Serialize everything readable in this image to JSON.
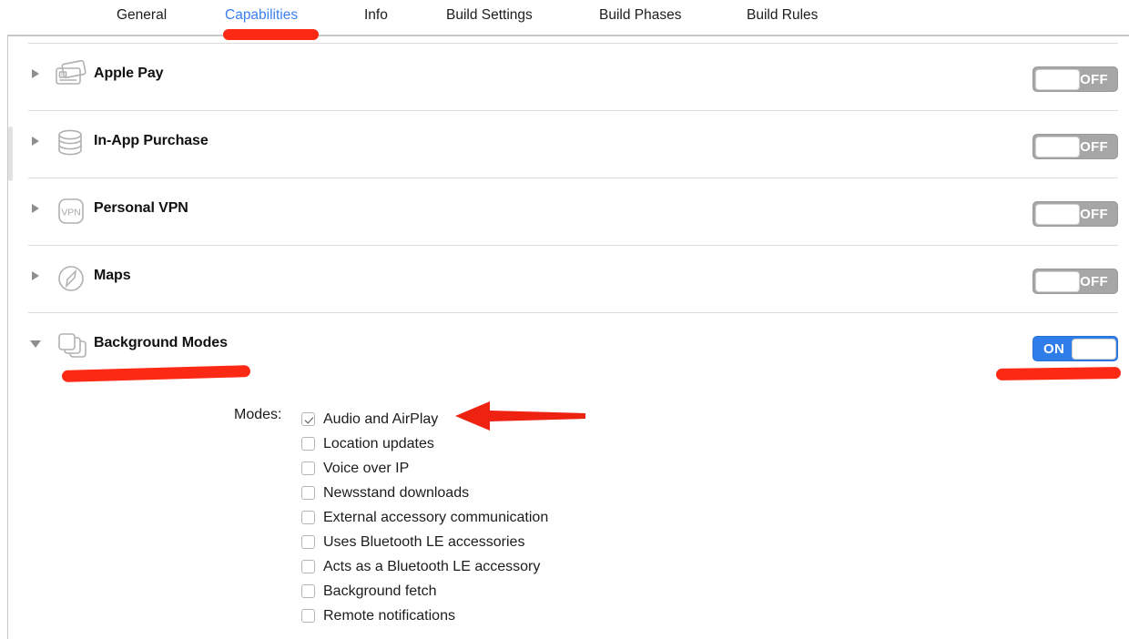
{
  "tabs": [
    {
      "label": "General",
      "active": false
    },
    {
      "label": "Capabilities",
      "active": true
    },
    {
      "label": "Info",
      "active": false
    },
    {
      "label": "Build Settings",
      "active": false
    },
    {
      "label": "Build Phases",
      "active": false
    },
    {
      "label": "Build Rules",
      "active": false
    }
  ],
  "capabilities": [
    {
      "label": "Apple Pay",
      "icon": "credit-cards-icon",
      "toggle": "OFF",
      "expanded": false
    },
    {
      "label": "In-App Purchase",
      "icon": "coin-stack-icon",
      "toggle": "OFF",
      "expanded": false
    },
    {
      "label": "Personal VPN",
      "icon": "vpn-badge-icon",
      "toggle": "OFF",
      "expanded": false
    },
    {
      "label": "Maps",
      "icon": "compass-icon",
      "toggle": "OFF",
      "expanded": false
    },
    {
      "label": "Background Modes",
      "icon": "stacked-squares-icon",
      "toggle": "ON",
      "expanded": true
    }
  ],
  "background_modes": {
    "section_label": "Modes:",
    "items": [
      {
        "label": "Audio and AirPlay",
        "checked": true
      },
      {
        "label": "Location updates",
        "checked": false
      },
      {
        "label": "Voice over IP",
        "checked": false
      },
      {
        "label": "Newsstand downloads",
        "checked": false
      },
      {
        "label": "External accessory communication",
        "checked": false
      },
      {
        "label": "Uses Bluetooth LE accessories",
        "checked": false
      },
      {
        "label": "Acts as a Bluetooth LE accessory",
        "checked": false
      },
      {
        "label": "Background fetch",
        "checked": false
      },
      {
        "label": "Remote notifications",
        "checked": false
      }
    ]
  },
  "vpn_icon_text": "VPN",
  "colors": {
    "active_tab": "#3b7ff0",
    "toggle_on": "#2e7de8",
    "toggle_off": "#a6a6a6",
    "annotation_red": "#fc2a15",
    "separator": "#dcdcdc"
  }
}
